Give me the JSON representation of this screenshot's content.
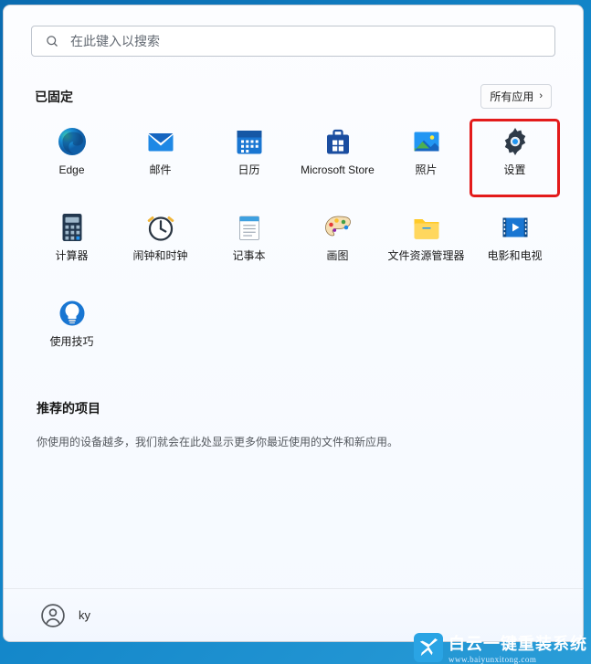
{
  "search": {
    "placeholder": "在此键入以搜索"
  },
  "pinned": {
    "title": "已固定",
    "all_apps_label": "所有应用",
    "apps": [
      {
        "label": "Edge",
        "icon": "edge"
      },
      {
        "label": "邮件",
        "icon": "mail"
      },
      {
        "label": "日历",
        "icon": "calendar"
      },
      {
        "label": "Microsoft Store",
        "icon": "store"
      },
      {
        "label": "照片",
        "icon": "photos"
      },
      {
        "label": "设置",
        "icon": "settings",
        "highlighted": true
      },
      {
        "label": "计算器",
        "icon": "calculator"
      },
      {
        "label": "闹钟和时钟",
        "icon": "clock"
      },
      {
        "label": "记事本",
        "icon": "notepad"
      },
      {
        "label": "画图",
        "icon": "paint"
      },
      {
        "label": "文件资源管理器",
        "icon": "explorer"
      },
      {
        "label": "电影和电视",
        "icon": "movies"
      },
      {
        "label": "使用技巧",
        "icon": "tips"
      }
    ]
  },
  "recommended": {
    "title": "推荐的项目",
    "message": "你使用的设备越多，我们就会在此处显示更多你最近使用的文件和新应用。"
  },
  "user": {
    "name": "ky"
  },
  "watermark": {
    "title": "白云一键重装系统",
    "subtitle": "www.baiyunxitong.com"
  }
}
